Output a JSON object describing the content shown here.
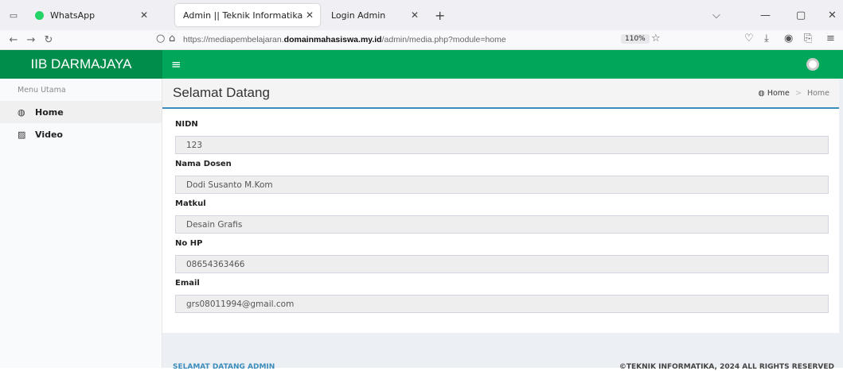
{
  "browser": {
    "tabs": [
      {
        "label": "WhatsApp"
      },
      {
        "label": "Admin || Teknik Informatika"
      },
      {
        "label": "Login Admin"
      }
    ],
    "url_prefix": "https://mediapembelajaran.",
    "url_domain": "domainmahasiswa.my.id",
    "url_path": "/admin/media.php?module=home",
    "zoom": "110%"
  },
  "header": {
    "brand": "IIB DARMAJAYA"
  },
  "sidebar": {
    "menu_header": "Menu Utama",
    "items": [
      {
        "label": "Home",
        "icon": "dashboard-icon"
      },
      {
        "label": "Video",
        "icon": "image-icon"
      }
    ]
  },
  "main": {
    "title": "Selamat Datang",
    "breadcrumb": [
      "Home",
      "Home"
    ],
    "fields": [
      {
        "label": "NIDN",
        "value": "123"
      },
      {
        "label": "Nama Dosen",
        "value": "Dodi Susanto M.Kom"
      },
      {
        "label": "Matkul",
        "value": "Desain Grafis"
      },
      {
        "label": "No HP",
        "value": "08654363466"
      },
      {
        "label": "Email",
        "value": "grs08011994@gmail.com"
      }
    ]
  },
  "footer": {
    "left": "SELAMAT DATANG ADMIN",
    "right": "©TEKNIK INFORMATIKA, 2024 ALL RIGHTS RESERVED"
  },
  "colors": {
    "header_green": "#00a65a",
    "brand_green": "#008d4c",
    "accent_blue": "#3c8dbc"
  }
}
